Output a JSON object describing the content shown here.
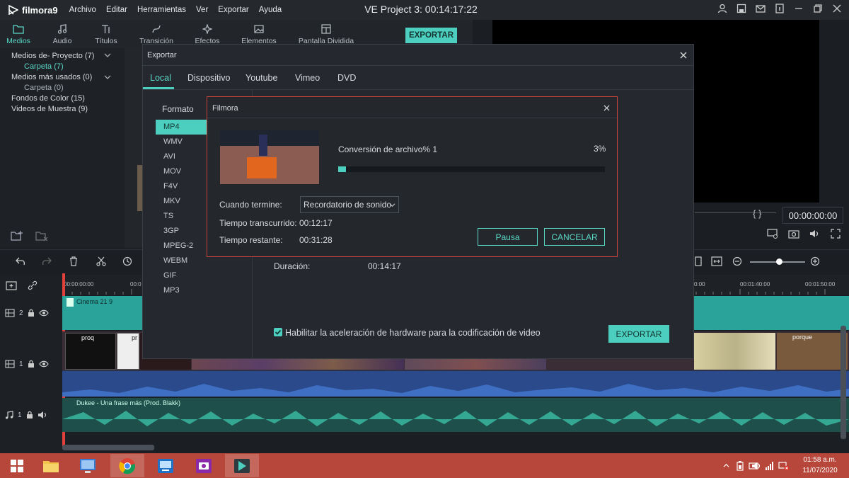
{
  "app": {
    "logo_text": "filmora9",
    "menu": [
      "Archivo",
      "Editar",
      "Herramientas",
      "Ver",
      "Exportar",
      "Ayuda"
    ],
    "project_title": "VE Project 3:  00:14:17:22"
  },
  "toolbar": {
    "tabs": [
      {
        "label": "Medios",
        "icon": "folder-icon",
        "active": true
      },
      {
        "label": "Audio",
        "icon": "music-note-icon"
      },
      {
        "label": "Títulos",
        "icon": "title-text-icon"
      },
      {
        "label": "Transición",
        "icon": "transition-icon"
      },
      {
        "label": "Efectos",
        "icon": "effects-icon"
      },
      {
        "label": "Elementos",
        "icon": "image-icon"
      },
      {
        "label": "Pantalla Dividida",
        "icon": "split-screen-icon"
      }
    ],
    "export_label": "EXPORTAR"
  },
  "left_panel": {
    "tree": [
      {
        "label": "Medios de- Proyecto (7)",
        "level": 0
      },
      {
        "label": "Carpeta (7)",
        "level": 1,
        "selected": true
      },
      {
        "label": "Medios más usados (0)",
        "level": 0
      },
      {
        "label": "Carpeta (0)",
        "level": 1
      },
      {
        "label": "Fondos de Color (15)",
        "level": 0
      },
      {
        "label": "Videos de Muestra (9)",
        "level": 0
      }
    ]
  },
  "preview": {
    "timecode": "00:00:00:00",
    "braces": "{   }"
  },
  "timeline": {
    "ruler_labels": [
      "00:00:00:00",
      "00:0",
      "0:00",
      "00:01:40:00",
      "00:01:50:00"
    ],
    "v2_clip_label": "Cinema 21 9",
    "v1_clip_labels": [
      "proq",
      "pr",
      "porque"
    ],
    "audio_clip_label": "Dukee - Una frase más (Prod. Blakk)",
    "track_labels": [
      "2",
      "1",
      "1"
    ]
  },
  "export_dialog": {
    "title": "Exportar",
    "tabs": [
      "Local",
      "Dispositivo",
      "Youtube",
      "Vimeo",
      "DVD"
    ],
    "active_tab": "Local",
    "format_heading": "Formato",
    "formats": [
      "MP4",
      "WMV",
      "AVI",
      "MOV",
      "F4V",
      "MKV",
      "TS",
      "3GP",
      "MPEG-2",
      "WEBM",
      "GIF",
      "MP3"
    ],
    "selected_format": "MP4",
    "duration_label": "Duración:",
    "duration_value": "00:14:17",
    "hw_accel_label": "Habilitar la aceleración de hardware para la codificación de video",
    "hw_accel_checked": true,
    "export_label": "EXPORTAR"
  },
  "progress_dialog": {
    "title": "Filmora",
    "status": "Conversión de archivo% 1",
    "percent_text": "3%",
    "progress": 0.03,
    "when_done_label": "Cuando termine:",
    "when_done_value": "Recordatorio de sonido",
    "elapsed_label": "Tiempo transcurrido:",
    "elapsed_value": "00:12:17",
    "remaining_label": "Tiempo restante:",
    "remaining_value": "00:31:28",
    "pause_label": "Pausa",
    "cancel_label": "CANCELAR"
  },
  "taskbar": {
    "time": "01:58 a.m.",
    "date": "11/07/2020"
  },
  "colors": {
    "accent": "#4ccfbf",
    "dialog_border": "#c8443c",
    "taskbar": "#b7473a"
  }
}
